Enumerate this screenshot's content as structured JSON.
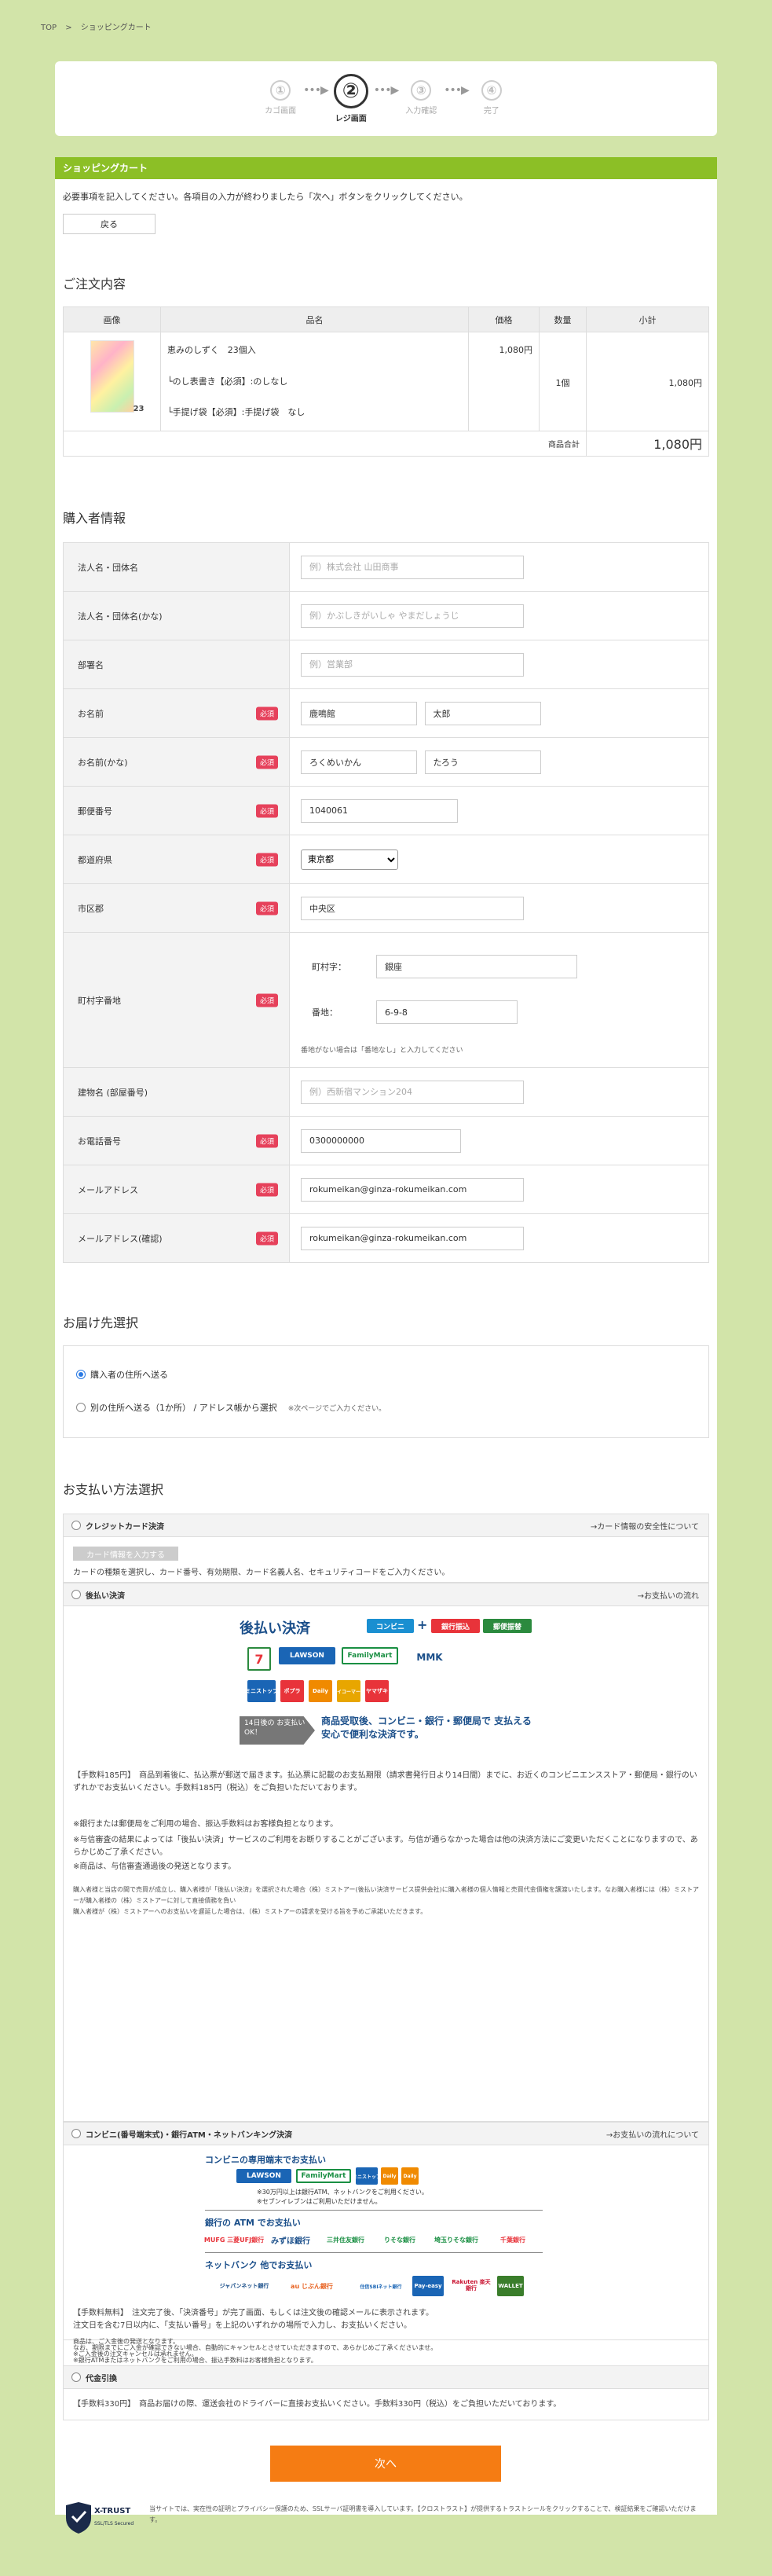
{
  "breadcrumb": [
    "TOP",
    ">",
    "ショッピングカート"
  ],
  "steps": [
    {
      "num": "①",
      "label": "カゴ画面"
    },
    {
      "num": "②",
      "label": "レジ画面"
    },
    {
      "num": "③",
      "label": "入力確認"
    },
    {
      "num": "④",
      "label": "完了"
    }
  ],
  "step_arrow": "•••▶",
  "cart": {
    "bar_title": "ショッピングカート",
    "intro": "必要事項を記入してください。各項目の入力が終わりましたら「次へ」ボタンをクリックしてください。",
    "back_label": "戻る"
  },
  "order": {
    "title": "ご注文内容",
    "headers": [
      "画像",
      "品名",
      "価格",
      "数量",
      "小計"
    ],
    "item": {
      "name": "恵みのしずく　23個入",
      "option1": "└のし表書き【必須】:のしなし",
      "option2": "└手提げ袋【必須】:手提げ袋　なし",
      "price": "1,080円",
      "qty": "1個",
      "subtotal": "1,080円"
    },
    "total_label": "商品合計",
    "total": "1,080円"
  },
  "buyer": {
    "title": "購入者情報",
    "required_badge": "必須",
    "fields": {
      "company": {
        "label": "法人名・団体名",
        "placeholder": "例）株式会社 山田商事"
      },
      "company_kana": {
        "label": "法人名・団体名(かな)",
        "placeholder": "例）かぶしきがいしゃ やまだしょうじ"
      },
      "dept": {
        "label": "部署名",
        "placeholder": "例）営業部"
      },
      "name": {
        "label": "お名前",
        "last": "鹿鳴館",
        "first": "太郎"
      },
      "name_kana": {
        "label": "お名前(かな)",
        "last": "ろくめいかん",
        "first": "たろう"
      },
      "zip": {
        "label": "郵便番号",
        "value": "1040061"
      },
      "pref": {
        "label": "都道府県",
        "value": "東京都"
      },
      "city": {
        "label": "市区郡",
        "value": "中央区"
      },
      "town": {
        "label": "町村字番地",
        "town_label": "町村字：",
        "town_value": "銀座",
        "num_label": "番地：",
        "num_value": "6-9-8",
        "note": "番地がない場合は「番地なし」と入力してください"
      },
      "building": {
        "label": "建物名 (部屋番号)",
        "placeholder": "例）西新宿マンション204"
      },
      "tel": {
        "label": "お電話番号",
        "value": "0300000000"
      },
      "email": {
        "label": "メールアドレス",
        "value": "rokumeikan@ginza-rokumeikan.com"
      },
      "email_confirm": {
        "label": "メールアドレス(確認)",
        "value": "rokumeikan@ginza-rokumeikan.com"
      }
    }
  },
  "delivery": {
    "title": "お届け先選択",
    "option1": "購入者の住所へ送る",
    "option2": "別の住所へ送る（1か所） / アドレス帳から選択",
    "option2_note": "※次ページでご入力ください。"
  },
  "payment": {
    "title": "お支払い方法選択",
    "credit": {
      "label": "クレジットカード決済",
      "link": "→カード情報の安全性について",
      "btn": "カード情報を入力する",
      "desc": "カードの種類を選択し、カード番号、有効期限、カード名義人名、セキュリティコードをご入力ください。"
    },
    "later": {
      "label": "後払い決済",
      "link": "→お支払いの流れ",
      "banner_title": "後払い決済",
      "banner_conveni": "コンビニ",
      "banner_plus": "+",
      "banner_bank": "銀行振込",
      "banner_post": "郵便振替",
      "banner_14": "14日後の お支払いOK！",
      "banner_msg": "商品受取後、コンビニ・銀行・郵便局で 支払える安心で便利な決済です。",
      "logos": [
        "LAWSON",
        "FamilyMart",
        "MMK",
        "7",
        "Daily",
        "ミニストップ",
        "ポプラ",
        "セイコーマート",
        "ヤマザキ"
      ],
      "fee": "【手数料185円】　商品到着後に、払込票が郵送で届きます。払込票に記載のお支払期限（請求書発行日より14日間）までに、お近くのコンビニエンスストア・郵便局・銀行のいずれかでお支払いください。手数料185円（税込）をご負担いただいております。",
      "note1": "※銀行または郵便局をご利用の場合、振込手数料はお客様負担となります。",
      "note2": "※与信審査の結果によっては「後払い決済」サービスのご利用をお断りすることがございます。与信が通らなかった場合は他の決済方法にご変更いただくことになりますので、あらかじめご了承ください。",
      "note3": "※商品は、与信審査通過後の発送となります。",
      "small1": "購入者様と当店の間で売買が成立し、購入者様が「後払い決済」を選択された場合（株）ミストアー(後払い決済サービス提供会社)に購入者様の個人情報と売買代金債権を譲渡いたします。なお購入者様には（株）ミストアーが購入者様の（株）ミストアーに対して直接債務を負い",
      "small2": "購入者様が（株）ミストアーへのお支払いを遅延した場合は、（株）ミストアーの請求を受ける旨を予めご承諾いただきます。"
    },
    "conveni": {
      "label": "コンビニ(番号端末式)・銀行ATM・ネットバンキング決済",
      "link": "→お支払いの流れについて",
      "sec1": "コンビニの専用端末でお支払い",
      "sec1_note1": "※30万円以上は銀行ATM、ネットバンクをご利用ください。",
      "sec1_note2": "※セブンイレブンはご利用いただけません。",
      "sec2": "銀行の ATM でお支払い",
      "sec3": "ネットバンク 他でお支払い",
      "logos1": [
        "LAWSON",
        "FamilyMart",
        "ミニストップ",
        "Daily",
        "Daily"
      ],
      "logos2": [
        "MUFG 三菱UFJ銀行",
        "みずほ銀行",
        "三井住友銀行",
        "りそな銀行",
        "埼玉りそな銀行",
        "千葉銀行"
      ],
      "logos3": [
        "ジャパンネット銀行",
        "au じぶん銀行",
        "住信SBIネット銀行",
        "Pay-easy",
        "Rakuten 楽天銀行",
        "WALLET"
      ],
      "fee": "【手数料無料】　注文完了後、「決済番号」が完了画面、もしくは注文後の確認メールに表示されます。",
      "line2": "注文日を含む7日以内に、「支払い番号」を上記のいずれかの場所で入力し、お支払いください。",
      "line3": "商品は、ご入金後の発送となります。",
      "line4": "なお、期限までにご入金が確認できない場合、自動的にキャンセルとさせていただきますので、あらかじめご了承くださいませ。",
      "note1": "※ご入金後の注文キャンセルは承れません。",
      "note2": "※銀行ATMまたはネットバンクをご利用の場合、振込手数料はお客様負担となります。"
    },
    "cod": {
      "label": "代金引換",
      "desc": "【手数料330円】　商品お届けの際、運送会社のドライバーに直接お支払いください。手数料330円（税込）をご負担いただいております。"
    }
  },
  "next_label": "次へ",
  "trust": {
    "brand": "X-TRUST",
    "sub": "SSL/TLS Secured",
    "text": "当サイトでは、実在性の証明とプライバシー保護のため、SSLサーバ証明書を導入しています。【クロストラスト】が提供するトラストシールをクリックすることで、検証結果をご確認いただけます。"
  },
  "colors": {
    "accent": "#8cbf26",
    "next": "#f57c13",
    "required": "#e6415b",
    "bg": "#d2e4a9"
  }
}
